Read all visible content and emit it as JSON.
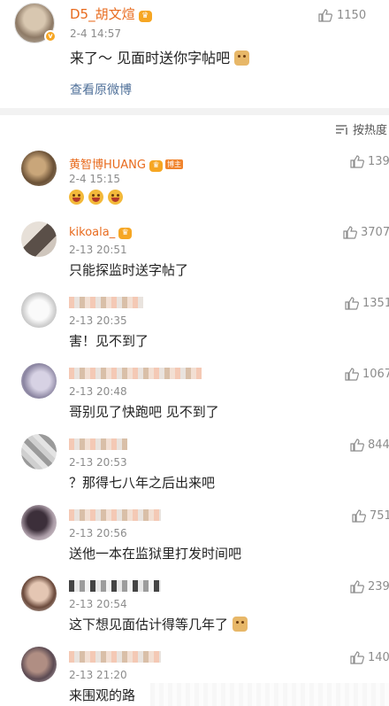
{
  "post": {
    "username": "D5_胡文煊",
    "time": "2-4 14:57",
    "likes": "1150",
    "text": "来了～ 见面时送你字帖吧",
    "view_original": "查看原微博"
  },
  "sort": {
    "label": "按热度"
  },
  "comments": [
    {
      "name": "黄智博HUANG",
      "time": "2-4 15:15",
      "text": "",
      "likes": "139",
      "badge": "博主"
    },
    {
      "name": "kikoala_",
      "time": "2-13 20:51",
      "text": "只能探监时送字帖了",
      "likes": "3707"
    },
    {
      "name": "",
      "time": "2-13 20:35",
      "text": "害！见不到了",
      "likes": "1351"
    },
    {
      "name": "",
      "time": "2-13 20:48",
      "text": "哥别见了快跑吧 见不到了",
      "likes": "1067"
    },
    {
      "name": "",
      "time": "2-13 20:53",
      "text": "？那得七八年之后出来吧",
      "likes": "844"
    },
    {
      "name": "",
      "time": "2-13 20:56",
      "text": "送他一本在监狱里打发时间吧",
      "likes": "751"
    },
    {
      "name": "",
      "time": "2-13 20:54",
      "text": "这下想见面估计得等几年了",
      "likes": "239"
    },
    {
      "name": "",
      "time": "2-13 21:20",
      "text": "来围观的路",
      "likes": "140"
    }
  ],
  "colors": {
    "username": "#e86b1e",
    "link": "#50719a",
    "badge": "#f6a623"
  },
  "icons": [
    "thumb-up-icon",
    "crown-icon",
    "verified-icon",
    "sort-icon",
    "laugh-emoji-icon",
    "doge-emoji-icon"
  ]
}
